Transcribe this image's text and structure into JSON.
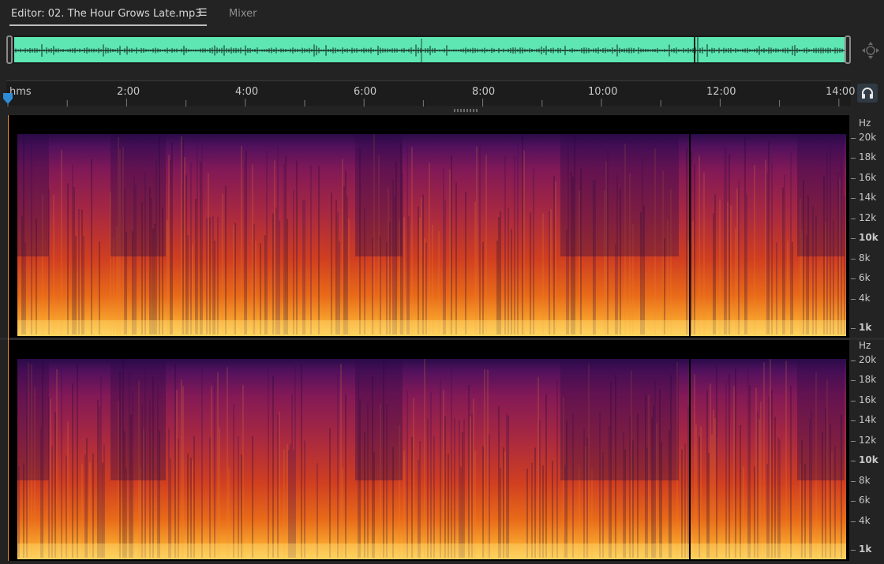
{
  "tabs": {
    "editor_label": "Editor: 02. The Hour Grows Late.mp3",
    "menu_icon": "☰",
    "mixer_label": "Mixer"
  },
  "overview": {
    "waveform_color": "#5ee6b3"
  },
  "ruler": {
    "labels": [
      "hms",
      "2:00",
      "4:00",
      "6:00",
      "8:00",
      "10:00",
      "12:00",
      "14:00"
    ]
  },
  "frequency_scale": {
    "unit": "Hz",
    "labels": [
      "20k",
      "18k",
      "16k",
      "14k",
      "12k",
      "10k",
      "8k",
      "6k",
      "4k",
      "1k"
    ]
  },
  "colors": {
    "accent": "#2e8bd6",
    "spectrogram_low": "#fdd158",
    "spectrogram_mid": "#d03f20",
    "spectrogram_high": "#52115d"
  }
}
